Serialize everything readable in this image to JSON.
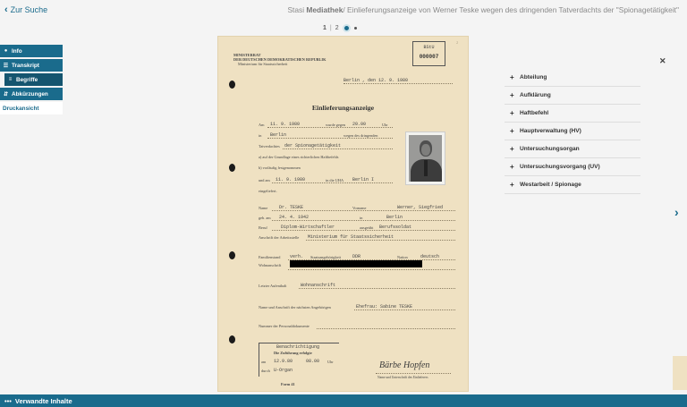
{
  "header": {
    "back_label": "Zur Suche",
    "title_prefix": "Stasi",
    "title_bold": "Mediathek",
    "title_rest": "/ Einlieferungsanzeige von Werner Teske wegen des dringenden Tatverdachts der \"Spionagetätigkeit\""
  },
  "pager": {
    "current": "1",
    "separator": "|",
    "total": "2"
  },
  "nav": {
    "info": "Info",
    "transkript": "Transkript",
    "begriffe": "Begriffe",
    "abkuerzungen": "Abkürzungen",
    "druckansicht": "Druckansicht"
  },
  "document": {
    "org_line1": "MINISTERRAT",
    "org_line2": "DER DEUTSCHEN DEMOKRATISCHEN REPUBLIK",
    "org_line3": "Ministerium für Staatssicherheit",
    "stamp_top": "BStU",
    "stamp_number": "000007",
    "page_no": "2",
    "place_date": "Berlin , den 12. 9. 1980",
    "heading": "Einlieferungsanzeige",
    "am_label": "Am",
    "am_value": "11. 9. 1980",
    "wurde_label": "wurde gegen",
    "time_value": "20.00",
    "uhr_label": "Uhr",
    "in_label": "in",
    "in_value": "Berlin",
    "wegen_label": "wegen des dringenden",
    "tatverdacht_label": "Tatverdachtes",
    "tatverdacht_value": "der Spionagetätigkeit",
    "grundlage": "a) auf der Grundlage eines richterlichen Haftbefehls",
    "festgenommen": "b) vorläufig festgenommen",
    "und_am_label": "und am",
    "und_am_value": "11. 9. 1980",
    "uha_label": "in die UHA",
    "uha_value": "Berlin I",
    "eingeliefert": "eingeliefert.",
    "name_label": "Name",
    "name_value": "Dr. TESKE",
    "vorname_label": "Vorname",
    "vorname_value": "Werner, Siegfried",
    "geb_label": "geb. am",
    "geb_value": "24. 4. 1942",
    "geb_in_label": "in",
    "geb_in_value": "Berlin",
    "beruf_label": "Beruf",
    "beruf_value": "Diplom-Wirtschaftler",
    "ausgeubt_label": "ausgeübt",
    "ausgeubt_value": "Berufssoldat",
    "arbeitsstelle_label": "Anschrift der Arbeitsstelle",
    "arbeitsstelle_value": "Ministerium für Staatssicherheit",
    "famstand_label": "Familienstand",
    "famstand_value": "verh.",
    "staat_label": "Staatsangehörigkeit",
    "staat_value": "DDR",
    "nation_label": "Nation",
    "nation_value": "deutsch",
    "wohnanschrift_label": "Wohnanschrift",
    "letzter_label": "Letzter Aufenthalt",
    "letzter_value": "Wohnanschrift",
    "angehoerige_label": "Name und Anschrift der nächsten Angehörigen",
    "angehoerige_value": "Ehefrau: Sabine TESKE",
    "personaldokumente_label": "Nummer der Personaldokumente",
    "benachrichtigung": "Benachrichtigung",
    "zufuehrung": "Die Zuführung erfolgte",
    "box_am_label": "am",
    "box_am_value": "12.9.80",
    "box_time_value": "08.00",
    "box_uhr_label": "Uhr",
    "durch_label": "durch",
    "durch_value": "U-Organ",
    "signature": "Bärbe Hopfen",
    "unterschrift": "Name und Unterschrift des Einlieferers",
    "form_code": "Form 41"
  },
  "begriffe": {
    "items": [
      "Abteilung",
      "Aufklärung",
      "Haftbefehl",
      "Hauptverwaltung (HV)",
      "Untersuchungsorgan",
      "Untersuchungsvorgang (UV)",
      "Westarbeit / Spionage"
    ]
  },
  "footer": {
    "label": "Verwandte Inhalte"
  },
  "colors": {
    "accent": "#1a6b8c",
    "paper": "#efe1c2",
    "background": "#f4f4f4"
  },
  "icons": {
    "back": "chevron-left-icon",
    "close": "close-icon",
    "next": "chevron-right-icon",
    "item": "plus-icon",
    "footer": "more-dots-icon"
  }
}
